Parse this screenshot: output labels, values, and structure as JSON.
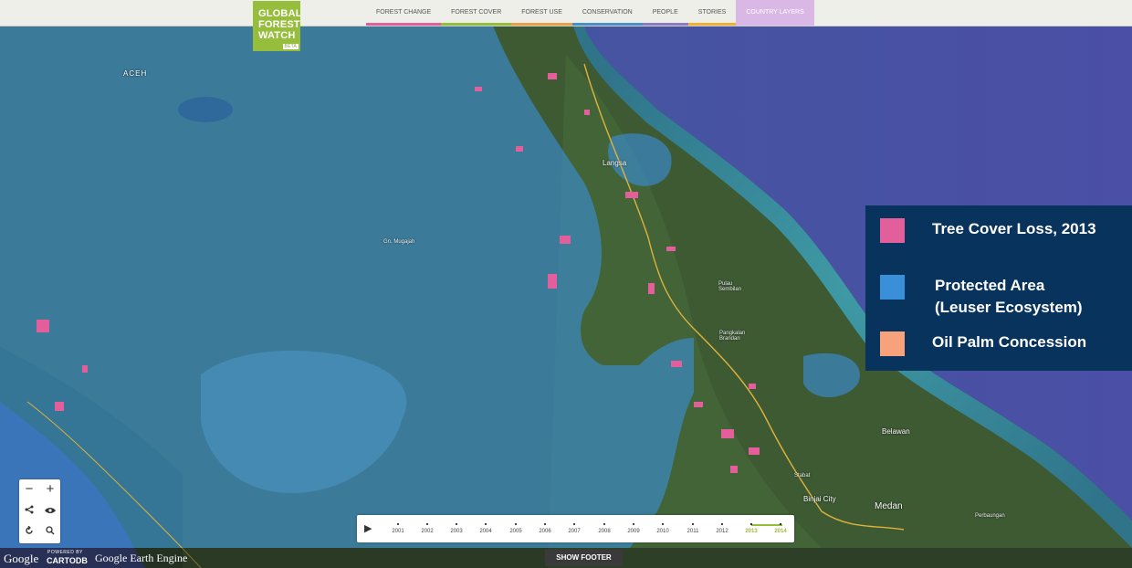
{
  "nav": {
    "logo_lines": [
      "GLOBAL",
      "FOREST",
      "WATCH"
    ],
    "logo_badge": "BETA",
    "items": [
      {
        "label": "FOREST CHANGE",
        "color": "#e35f9b"
      },
      {
        "label": "FOREST COVER",
        "color": "#97bd3d"
      },
      {
        "label": "FOREST USE",
        "color": "#e8a04a"
      },
      {
        "label": "CONSERVATION",
        "color": "#4a90c8"
      },
      {
        "label": "PEOPLE",
        "color": "#8e7cc3"
      },
      {
        "label": "STORIES",
        "color": "#f2b134"
      },
      {
        "label": "COUNTRY LAYERS",
        "color": "#d9b8e6"
      }
    ]
  },
  "legend": {
    "items": [
      {
        "label_lines": [
          "Tree Cover Loss, 2013"
        ],
        "color": "#e35f9b"
      },
      {
        "label_lines": [
          "Protected Area",
          "(Leuser Ecosystem)"
        ],
        "color": "#3a8fd9"
      },
      {
        "label_lines": [
          "Oil Palm Concession"
        ],
        "color": "#f8a27c"
      }
    ]
  },
  "map_labels": {
    "aceh": "ACEH",
    "langsa": "Langsa",
    "pulau_sembilan": "Pulau Sembilan",
    "pangkalan_brandan": "Pangkalan Brandan",
    "stabat": "Stabat",
    "belawan": "Belawan",
    "binjai": "Binjai City",
    "medan": "Medan",
    "perbaungan": "Perbaungan",
    "mount": "Gn. Mugajah"
  },
  "controls": {
    "zoom_in": "+",
    "zoom_out": "−",
    "play": "▶",
    "show_footer": "SHOW FOOTER"
  },
  "timeline": {
    "years": [
      "2001",
      "2002",
      "2003",
      "2004",
      "2005",
      "2006",
      "2007",
      "2008",
      "2009",
      "2010",
      "2011",
      "2012",
      "2013",
      "2014"
    ],
    "highlighted": [
      "2013",
      "2014"
    ]
  },
  "credits": {
    "google": "Google",
    "cartodb_small": "POWERED BY",
    "cartodb": "CARTODB",
    "earth_engine": "Google Earth Engine"
  },
  "icons": {
    "share": "share-icon",
    "eye": "eye-icon",
    "refresh": "refresh-icon",
    "search": "search-icon"
  },
  "colors": {
    "forest_green": "#97bd3d",
    "legend_bg": "#07335d",
    "protected": "#3a8fd9",
    "loss": "#e35f9b",
    "ocean": "#4a5aa8"
  }
}
